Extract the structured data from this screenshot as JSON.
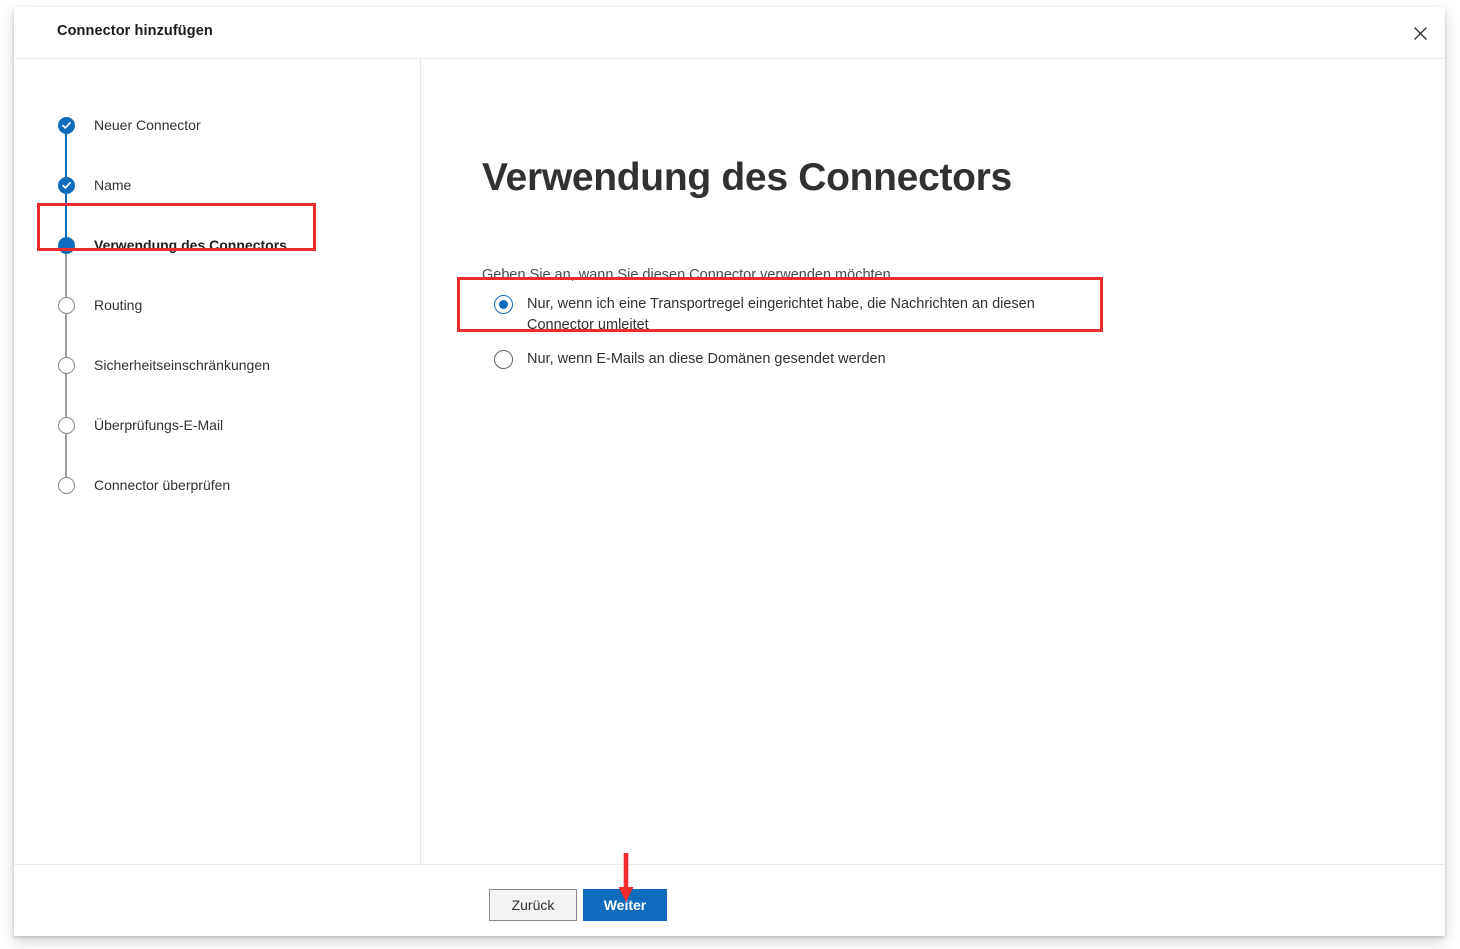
{
  "dialog": {
    "title": "Connector hinzufügen",
    "close_icon": "close-icon"
  },
  "wizard": {
    "steps": [
      {
        "label": "Neuer Connector",
        "state": "done"
      },
      {
        "label": "Name",
        "state": "done"
      },
      {
        "label": "Verwendung des Connectors",
        "state": "current"
      },
      {
        "label": "Routing",
        "state": "pending"
      },
      {
        "label": "Sicherheitseinschränkungen",
        "state": "pending"
      },
      {
        "label": "Überprüfungs-E-Mail",
        "state": "pending"
      },
      {
        "label": "Connector überprüfen",
        "state": "pending"
      }
    ]
  },
  "content": {
    "heading": "Verwendung des Connectors",
    "subtext": "Geben Sie an, wann Sie diesen Connector verwenden möchten.",
    "options": [
      {
        "label": "Nur, wenn ich eine Transportregel eingerichtet habe, die Nachrichten an diesen Connector umleitet",
        "selected": true
      },
      {
        "label": "Nur, wenn E-Mails an diese Domänen gesendet werden",
        "selected": false
      }
    ]
  },
  "footer": {
    "back_label": "Zurück",
    "next_label": "Weiter"
  },
  "annotations": {
    "highlight_color": "#ec2c2c",
    "arrow_color": "#f22d2d"
  },
  "colors": {
    "accent": "#0f6cbd",
    "primary_button": "#0f6cbd",
    "text": "#323130",
    "pending_bullet": "#8a8886"
  }
}
